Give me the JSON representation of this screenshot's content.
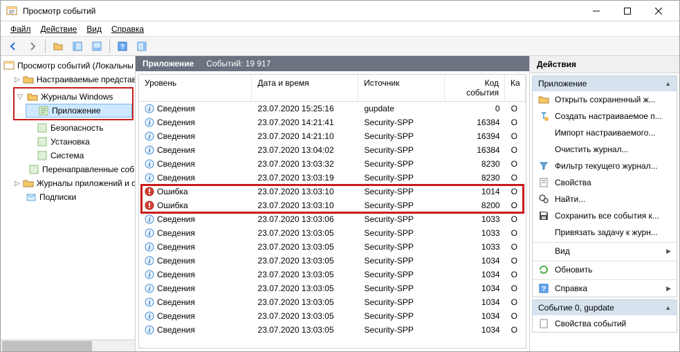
{
  "window": {
    "title": "Просмотр событий"
  },
  "menus": {
    "file": "Файл",
    "action": "Действие",
    "view": "Вид",
    "help": "Справка"
  },
  "tree": {
    "root": "Просмотр событий (Локальны",
    "custom": "Настраиваемые представле",
    "winlogs": "Журналы Windows",
    "application": "Приложение",
    "security": "Безопасность",
    "setup": "Установка",
    "system": "Система",
    "forwarded": "Перенаправленные соб",
    "applogs": "Журналы приложений и сл",
    "subs": "Подписки"
  },
  "grid": {
    "title": "Приложение",
    "count_label": "Событий: 19 917",
    "cols": {
      "level": "Уровень",
      "date": "Дата и время",
      "source": "Источник",
      "eventid": "Код события",
      "cat": "Ка"
    },
    "level_info": "Сведения",
    "level_error": "Ошибка",
    "rows": [
      {
        "lvl": "info",
        "date": "23.07.2020 15:25:16",
        "src": "gupdate",
        "id": "0",
        "cat": "О"
      },
      {
        "lvl": "info",
        "date": "23.07.2020 14:21:41",
        "src": "Security-SPP",
        "id": "16384",
        "cat": "О"
      },
      {
        "lvl": "info",
        "date": "23.07.2020 14:21:10",
        "src": "Security-SPP",
        "id": "16394",
        "cat": "О"
      },
      {
        "lvl": "info",
        "date": "23.07.2020 13:04:02",
        "src": "Security-SPP",
        "id": "16384",
        "cat": "О"
      },
      {
        "lvl": "info",
        "date": "23.07.2020 13:03:32",
        "src": "Security-SPP",
        "id": "8230",
        "cat": "О"
      },
      {
        "lvl": "info",
        "date": "23.07.2020 13:03:19",
        "src": "Security-SPP",
        "id": "8230",
        "cat": "О"
      },
      {
        "lvl": "error",
        "date": "23.07.2020 13:03:10",
        "src": "Security-SPP",
        "id": "1014",
        "cat": "О"
      },
      {
        "lvl": "error",
        "date": "23.07.2020 13:03:10",
        "src": "Security-SPP",
        "id": "8200",
        "cat": "О"
      },
      {
        "lvl": "info",
        "date": "23.07.2020 13:03:06",
        "src": "Security-SPP",
        "id": "1033",
        "cat": "О"
      },
      {
        "lvl": "info",
        "date": "23.07.2020 13:03:05",
        "src": "Security-SPP",
        "id": "1033",
        "cat": "О"
      },
      {
        "lvl": "info",
        "date": "23.07.2020 13:03:05",
        "src": "Security-SPP",
        "id": "1033",
        "cat": "О"
      },
      {
        "lvl": "info",
        "date": "23.07.2020 13:03:05",
        "src": "Security-SPP",
        "id": "1034",
        "cat": "О"
      },
      {
        "lvl": "info",
        "date": "23.07.2020 13:03:05",
        "src": "Security-SPP",
        "id": "1034",
        "cat": "О"
      },
      {
        "lvl": "info",
        "date": "23.07.2020 13:03:05",
        "src": "Security-SPP",
        "id": "1034",
        "cat": "О"
      },
      {
        "lvl": "info",
        "date": "23.07.2020 13:03:05",
        "src": "Security-SPP",
        "id": "1034",
        "cat": "О"
      },
      {
        "lvl": "info",
        "date": "23.07.2020 13:03:05",
        "src": "Security-SPP",
        "id": "1034",
        "cat": "О"
      },
      {
        "lvl": "info",
        "date": "23.07.2020 13:03:05",
        "src": "Security-SPP",
        "id": "1034",
        "cat": "О"
      }
    ]
  },
  "actions": {
    "title": "Действия",
    "sec_app": "Приложение",
    "open_saved": "Открыть сохраненный ж...",
    "create_custom": "Создать настраиваемое п...",
    "import_custom": "Импорт настраиваемого...",
    "clear_log": "Очистить журнал...",
    "filter_current": "Фильтр текущего журнал...",
    "properties": "Свойства",
    "find": "Найти...",
    "save_all": "Сохранить все события к...",
    "attach_task": "Привязать задачу к журн...",
    "view": "Вид",
    "refresh": "Обновить",
    "help": "Справка",
    "sec_event": "Событие 0, gupdate",
    "event_props": "Свойства событий"
  }
}
